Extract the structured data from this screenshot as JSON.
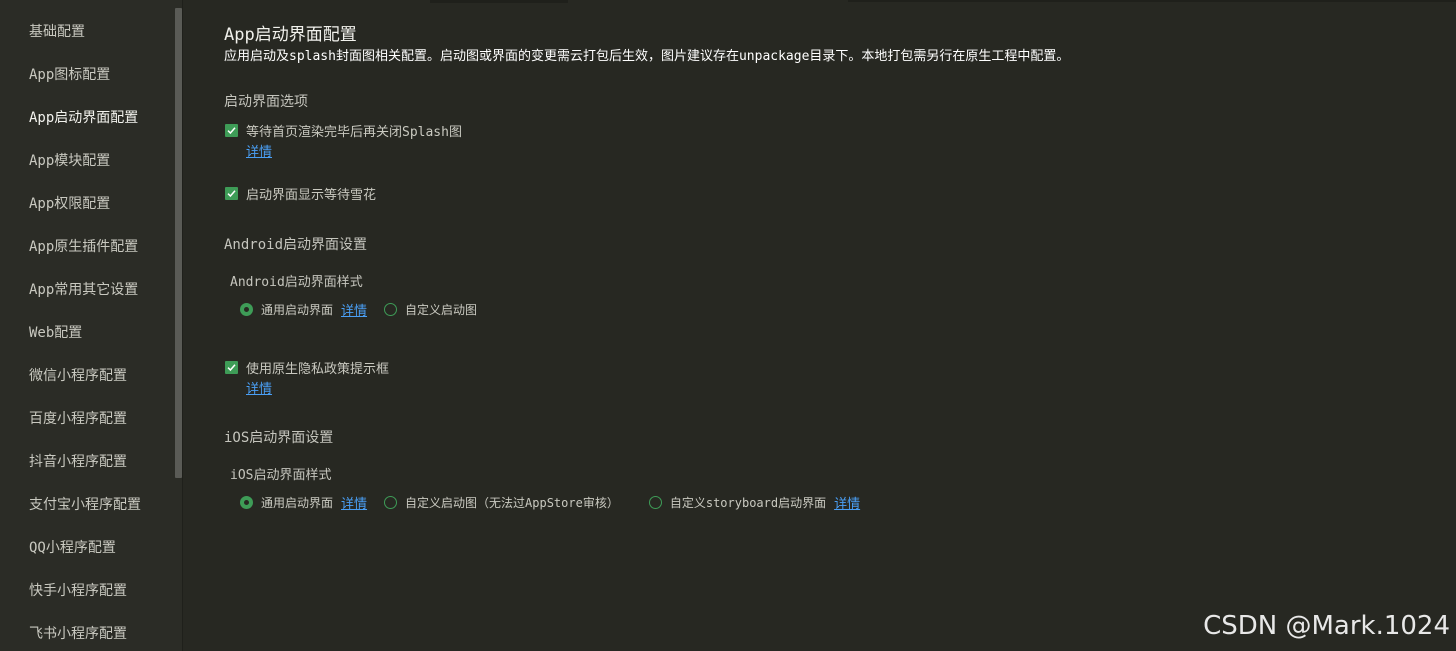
{
  "sidebar": {
    "items": [
      {
        "label": "基础配置"
      },
      {
        "label": "App图标配置"
      },
      {
        "label": "App启动界面配置",
        "active": true
      },
      {
        "label": "App模块配置"
      },
      {
        "label": "App权限配置"
      },
      {
        "label": "App原生插件配置"
      },
      {
        "label": "App常用其它设置"
      },
      {
        "label": "Web配置"
      },
      {
        "label": "微信小程序配置"
      },
      {
        "label": "百度小程序配置"
      },
      {
        "label": "抖音小程序配置"
      },
      {
        "label": "支付宝小程序配置"
      },
      {
        "label": "QQ小程序配置"
      },
      {
        "label": "快手小程序配置"
      },
      {
        "label": "飞书小程序配置"
      }
    ]
  },
  "page": {
    "title": "App启动界面配置",
    "description": "应用启动及splash封面图相关配置。启动图或界面的变更需云打包后生效，图片建议存在unpackage目录下。本地打包需另行在原生工程中配置。"
  },
  "splash_options": {
    "section_title": "启动界面选项",
    "wait_render": {
      "label": "等待首页渲染完毕后再关闭Splash图",
      "checked": true,
      "link": "详情"
    },
    "show_snowflake": {
      "label": "启动界面显示等待雪花",
      "checked": true
    }
  },
  "android": {
    "section_title": "Android启动界面设置",
    "style_title": "Android启动界面样式",
    "options": [
      {
        "label": "通用启动界面",
        "checked": true,
        "link": "详情"
      },
      {
        "label": "自定义启动图",
        "checked": false
      }
    ],
    "privacy": {
      "label": "使用原生隐私政策提示框",
      "checked": true,
      "link": "详情"
    }
  },
  "ios": {
    "section_title": "iOS启动界面设置",
    "style_title": "iOS启动界面样式",
    "options": [
      {
        "label": "通用启动界面",
        "checked": true,
        "link": "详情"
      },
      {
        "label": "自定义启动图（无法过AppStore审核）",
        "checked": false
      },
      {
        "label": "自定义storyboard启动界面",
        "checked": false,
        "link": "详情"
      }
    ]
  },
  "watermark": "CSDN @Mark.1024",
  "colors": {
    "background": "#272822",
    "sidebar": "#2b2c26",
    "accent_green": "#3e9c57",
    "link_blue": "#4a9ff5"
  }
}
